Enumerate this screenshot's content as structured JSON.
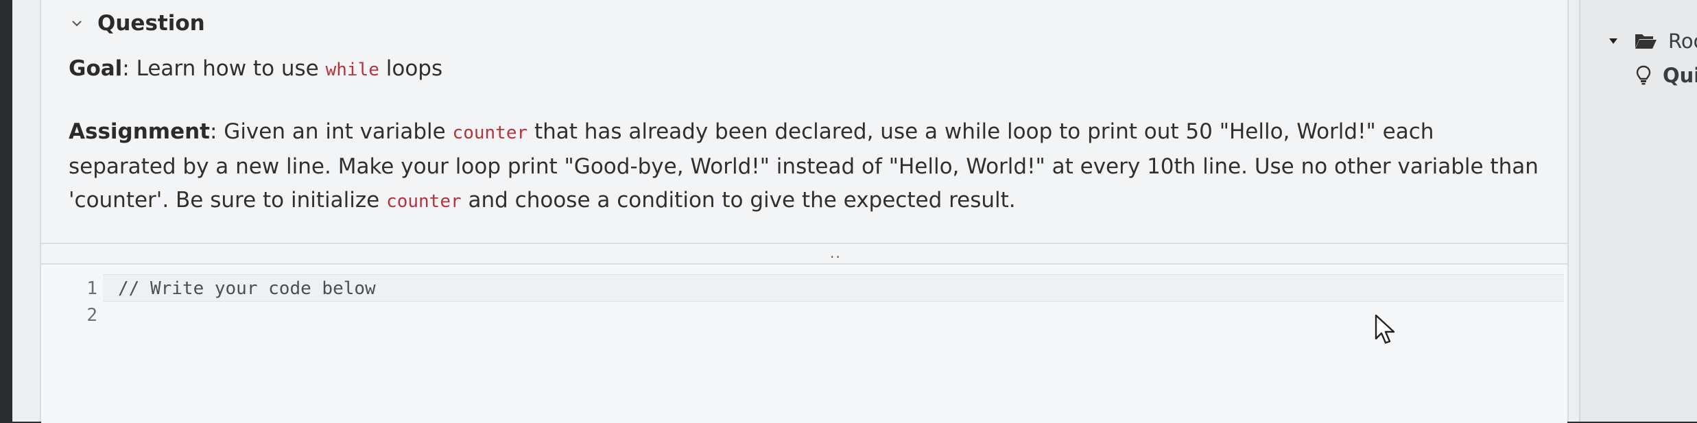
{
  "question": {
    "title": "Question",
    "goal_label": "Goal",
    "goal_text_before": ": Learn how to use ",
    "goal_keyword": "while",
    "goal_text_after": " loops",
    "assignment_label": "Assignment",
    "assignment_parts": [
      ": Given an int variable ",
      "counter",
      " that has already been declared, use a while loop to print out 50 \"Hello, World!\" each separated by a new line. Make your loop print \"Good-bye, World!\" instead of \"Hello, World!\" at every 10th line. Use no other variable than 'counter'. Be sure to initialize ",
      "counter",
      " and choose a condition to give the expected result."
    ]
  },
  "editor": {
    "drag_handle": "..",
    "lines": [
      {
        "number": "1",
        "code": "// Write your code below"
      },
      {
        "number": "2",
        "code": ""
      }
    ]
  },
  "side_panel": {
    "items": [
      {
        "label": "Roo",
        "icon": "folder-open-icon",
        "expanded": true
      },
      {
        "label": "Qui",
        "icon": "lightbulb-icon"
      }
    ]
  },
  "colors": {
    "code_keyword": "#b5333d",
    "panel_bg": "#f3f4f5",
    "page_bg": "#eceef0"
  }
}
